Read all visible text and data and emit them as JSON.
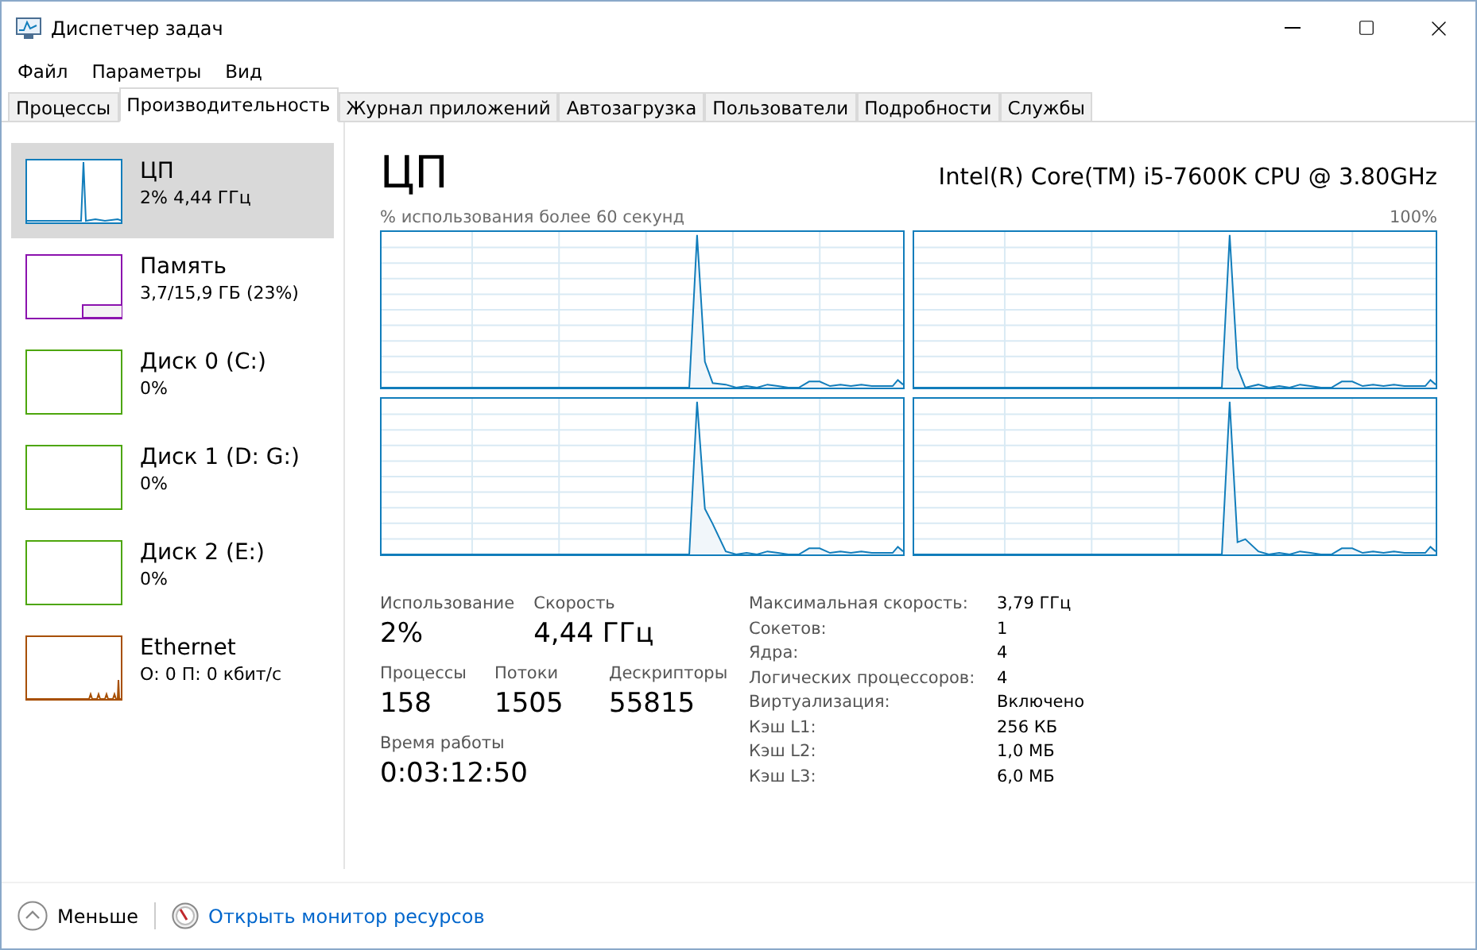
{
  "window": {
    "title": "Диспетчер задач"
  },
  "menu": [
    "Файл",
    "Параметры",
    "Вид"
  ],
  "tabs": [
    {
      "label": "Процессы",
      "selected": false
    },
    {
      "label": "Производительность",
      "selected": true
    },
    {
      "label": "Журнал приложений",
      "selected": false
    },
    {
      "label": "Автозагрузка",
      "selected": false
    },
    {
      "label": "Пользователи",
      "selected": false
    },
    {
      "label": "Подробности",
      "selected": false
    },
    {
      "label": "Службы",
      "selected": false
    }
  ],
  "sidebar": {
    "items": [
      {
        "kind": "cpu",
        "name": "ЦП",
        "detail": "2% 4,44 ГГц",
        "color": "#117dbb",
        "selected": true
      },
      {
        "kind": "memory",
        "name": "Память",
        "detail": "3,7/15,9 ГБ (23%)",
        "color": "#8b12ae",
        "selected": false
      },
      {
        "kind": "disk",
        "name": "Диск 0 (C:)",
        "detail": "0%",
        "color": "#4da60c",
        "selected": false
      },
      {
        "kind": "disk",
        "name": "Диск 1 (D: G:)",
        "detail": "0%",
        "color": "#4da60c",
        "selected": false
      },
      {
        "kind": "disk",
        "name": "Диск 2 (E:)",
        "detail": "0%",
        "color": "#4da60c",
        "selected": false
      },
      {
        "kind": "network",
        "name": "Ethernet",
        "detail": "О: 0 П: 0 кбит/с",
        "color": "#a74f01",
        "selected": false
      }
    ]
  },
  "panel": {
    "title": "ЦП",
    "device": "Intel(R) Core(TM) i5-7600K CPU @ 3.80GHz",
    "graph_caption": "% использования более 60 секунд",
    "graph_max": "100%",
    "graphs": [
      {
        "kind": "sparkline"
      },
      {
        "kind": "sparkline"
      },
      {
        "kind": "sparkline"
      },
      {
        "kind": "sparkline"
      }
    ],
    "stat_rows": [
      [
        {
          "label": "Использование",
          "value": "2%"
        },
        {
          "label": "Скорость",
          "value": "4,44 ГГц"
        }
      ],
      [
        {
          "label": "Процессы",
          "value": "158"
        },
        {
          "label": "Потоки",
          "value": "1505"
        },
        {
          "label": "Дескрипторы",
          "value": "55815"
        }
      ],
      [
        {
          "label": "Время работы",
          "value": "0:03:12:50"
        }
      ]
    ],
    "details": [
      {
        "label": "Максимальная скорость:",
        "value": "3,79 ГГц"
      },
      {
        "label": "Сокетов:",
        "value": "1"
      },
      {
        "label": "Ядра:",
        "value": "4"
      },
      {
        "label": "Логических процессоров:",
        "value": "4"
      },
      {
        "label": "Виртуализация:",
        "value": "Включено"
      },
      {
        "label": "Кэш L1:",
        "value": "256 КБ"
      },
      {
        "label": "Кэш L2:",
        "value": "1,0 МБ"
      },
      {
        "label": "Кэш L3:",
        "value": "6,0 МБ"
      }
    ]
  },
  "footer": {
    "fewer": "Меньше",
    "link": "Открыть монитор ресурсов"
  }
}
